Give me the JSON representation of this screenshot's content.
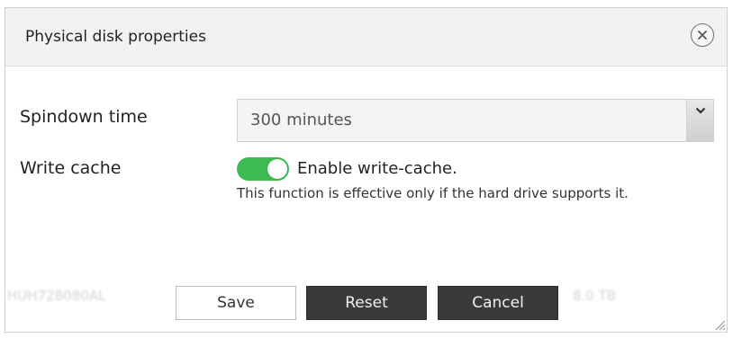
{
  "dialog": {
    "title": "Physical disk properties",
    "close_icon": "close-circle-icon"
  },
  "form": {
    "spindown": {
      "label": "Spindown time",
      "value": "300 minutes"
    },
    "write_cache": {
      "label": "Write cache",
      "toggle_on": true,
      "toggle_label": "Enable write-cache.",
      "hint": "This function is effective only if the hard drive supports it."
    }
  },
  "buttons": {
    "save": "Save",
    "reset": "Reset",
    "cancel": "Cancel"
  },
  "background_rows": {
    "bottom_model": "HUH728080AL",
    "bottom_size": "8.0 TB"
  },
  "colors": {
    "toggle_on": "#3dbb52",
    "dark_button": "#3a3a3a"
  }
}
